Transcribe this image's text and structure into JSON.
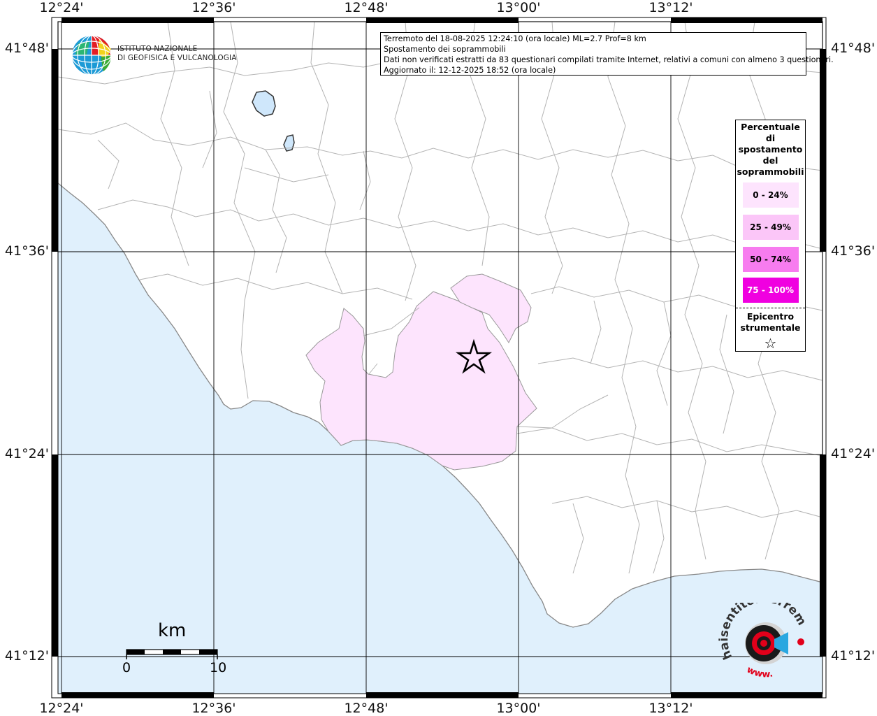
{
  "info": {
    "line1": "Terremoto del 18-08-2025 12:24:10 (ora locale) ML=2.7 Prof=8 km",
    "line2": "Spostamento dei soprammobili",
    "line3": "Dati non verificati estratti da 83 questionari compilati tramite Internet, relativi a comuni con almeno 3 questionari.",
    "line4": "Aggiornato il: 12-12-2025 18:52 (ora locale)"
  },
  "ingv": {
    "line1": "ISTITUTO NAZIONALE",
    "line2": "DI GEOFISICA E VULCANOLOGIA"
  },
  "axes": {
    "longitudes": [
      "12°24'",
      "12°36'",
      "12°48'",
      "13°00'",
      "13°12'"
    ],
    "latitudes": [
      "41°48'",
      "41°36'",
      "41°24'",
      "41°12'"
    ]
  },
  "legend": {
    "title": [
      "Percentuale",
      "di",
      "spostamento",
      "del",
      "soprammobili"
    ],
    "classes": [
      {
        "label": "0 - 24%",
        "color": "#fde4fd",
        "text_color": "#000000"
      },
      {
        "label": "25 - 49%",
        "color": "#fbc6f8",
        "text_color": "#000000"
      },
      {
        "label": "50 - 74%",
        "color": "#f77cef",
        "text_color": "#000000"
      },
      {
        "label": "75 - 100%",
        "color": "#f000e0",
        "text_color": "#ffffff"
      }
    ],
    "epicenter_label": [
      "Epicentro",
      "strumentale"
    ],
    "epicenter_symbol": "☆"
  },
  "scale": {
    "unit": "km",
    "start": "0",
    "end": "10"
  },
  "hsit": {
    "top_text": "haisentitoilterremoto.it",
    "bottom_text": "www."
  },
  "colors": {
    "sea": "#e0f0fc",
    "land": "#ffffff",
    "border": "#b4b4b4",
    "grid": "#000000"
  }
}
